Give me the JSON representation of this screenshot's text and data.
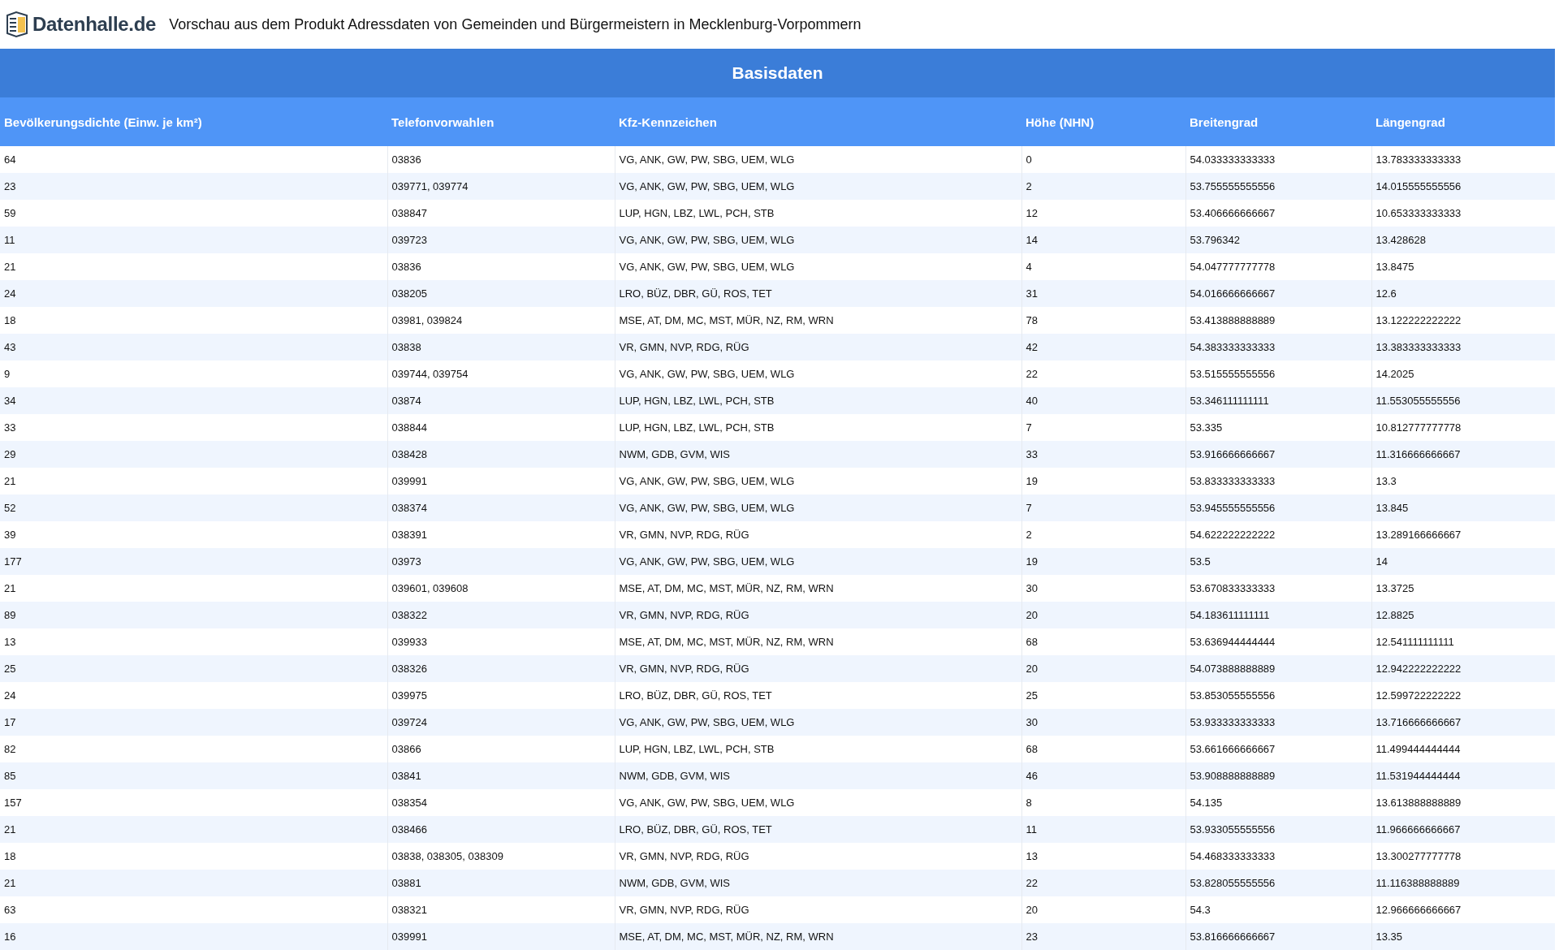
{
  "header": {
    "logo_text": "Datenhalle.de",
    "title": "Vorschau aus dem Produkt Adressdaten von Gemeinden und Bürgermeistern in Mecklenburg-Vorpommern"
  },
  "table": {
    "caption": "Basisdaten",
    "columns": [
      "Bevölkerungsdichte (Einw. je km²)",
      "Telefonvorwahlen",
      "Kfz-Kennzeichen",
      "Höhe (NHN)",
      "Breitengrad",
      "Längengrad"
    ],
    "rows": [
      [
        "64",
        "03836",
        "VG, ANK, GW, PW, SBG, UEM, WLG",
        "0",
        "54.033333333333",
        "13.783333333333"
      ],
      [
        "23",
        "039771, 039774",
        "VG, ANK, GW, PW, SBG, UEM, WLG",
        "2",
        "53.755555555556",
        "14.015555555556"
      ],
      [
        "59",
        "038847",
        "LUP, HGN, LBZ, LWL, PCH, STB",
        "12",
        "53.406666666667",
        "10.653333333333"
      ],
      [
        "11",
        "039723",
        "VG, ANK, GW, PW, SBG, UEM, WLG",
        "14",
        "53.796342",
        "13.428628"
      ],
      [
        "21",
        "03836",
        "VG, ANK, GW, PW, SBG, UEM, WLG",
        "4",
        "54.047777777778",
        "13.8475"
      ],
      [
        "24",
        "038205",
        "LRO, BÜZ, DBR, GÜ, ROS, TET",
        "31",
        "54.016666666667",
        "12.6"
      ],
      [
        "18",
        "03981, 039824",
        "MSE, AT, DM, MC, MST, MÜR, NZ, RM, WRN",
        "78",
        "53.413888888889",
        "13.122222222222"
      ],
      [
        "43",
        "03838",
        "VR, GMN, NVP, RDG, RÜG",
        "42",
        "54.383333333333",
        "13.383333333333"
      ],
      [
        "9",
        "039744, 039754",
        "VG, ANK, GW, PW, SBG, UEM, WLG",
        "22",
        "53.515555555556",
        "14.2025"
      ],
      [
        "34",
        "03874",
        "LUP, HGN, LBZ, LWL, PCH, STB",
        "40",
        "53.346111111111",
        "11.553055555556"
      ],
      [
        "33",
        "038844",
        "LUP, HGN, LBZ, LWL, PCH, STB",
        "7",
        "53.335",
        "10.812777777778"
      ],
      [
        "29",
        "038428",
        "NWM, GDB, GVM, WIS",
        "33",
        "53.916666666667",
        "11.316666666667"
      ],
      [
        "21",
        "039991",
        "VG, ANK, GW, PW, SBG, UEM, WLG",
        "19",
        "53.833333333333",
        "13.3"
      ],
      [
        "52",
        "038374",
        "VG, ANK, GW, PW, SBG, UEM, WLG",
        "7",
        "53.945555555556",
        "13.845"
      ],
      [
        "39",
        "038391",
        "VR, GMN, NVP, RDG, RÜG",
        "2",
        "54.622222222222",
        "13.289166666667"
      ],
      [
        "177",
        "03973",
        "VG, ANK, GW, PW, SBG, UEM, WLG",
        "19",
        "53.5",
        "14"
      ],
      [
        "21",
        "039601, 039608",
        "MSE, AT, DM, MC, MST, MÜR, NZ, RM, WRN",
        "30",
        "53.670833333333",
        "13.3725"
      ],
      [
        "89",
        "038322",
        "VR, GMN, NVP, RDG, RÜG",
        "20",
        "54.183611111111",
        "12.8825"
      ],
      [
        "13",
        "039933",
        "MSE, AT, DM, MC, MST, MÜR, NZ, RM, WRN",
        "68",
        "53.636944444444",
        "12.541111111111"
      ],
      [
        "25",
        "038326",
        "VR, GMN, NVP, RDG, RÜG",
        "20",
        "54.073888888889",
        "12.942222222222"
      ],
      [
        "24",
        "039975",
        "LRO, BÜZ, DBR, GÜ, ROS, TET",
        "25",
        "53.853055555556",
        "12.599722222222"
      ],
      [
        "17",
        "039724",
        "VG, ANK, GW, PW, SBG, UEM, WLG",
        "30",
        "53.933333333333",
        "13.716666666667"
      ],
      [
        "82",
        "03866",
        "LUP, HGN, LBZ, LWL, PCH, STB",
        "68",
        "53.661666666667",
        "11.499444444444"
      ],
      [
        "85",
        "03841",
        "NWM, GDB, GVM, WIS",
        "46",
        "53.908888888889",
        "11.531944444444"
      ],
      [
        "157",
        "038354",
        "VG, ANK, GW, PW, SBG, UEM, WLG",
        "8",
        "54.135",
        "13.613888888889"
      ],
      [
        "21",
        "038466",
        "LRO, BÜZ, DBR, GÜ, ROS, TET",
        "11",
        "53.933055555556",
        "11.966666666667"
      ],
      [
        "18",
        "03838, 038305, 038309",
        "VR, GMN, NVP, RDG, RÜG",
        "13",
        "54.468333333333",
        "13.300277777778"
      ],
      [
        "21",
        "03881",
        "NWM, GDB, GVM, WIS",
        "22",
        "53.828055555556",
        "11.116388888889"
      ],
      [
        "63",
        "038321",
        "VR, GMN, NVP, RDG, RÜG",
        "20",
        "54.3",
        "12.966666666667"
      ],
      [
        "16",
        "039991",
        "MSE, AT, DM, MC, MST, MÜR, NZ, RM, WRN",
        "23",
        "53.816666666667",
        "13.35"
      ]
    ]
  }
}
